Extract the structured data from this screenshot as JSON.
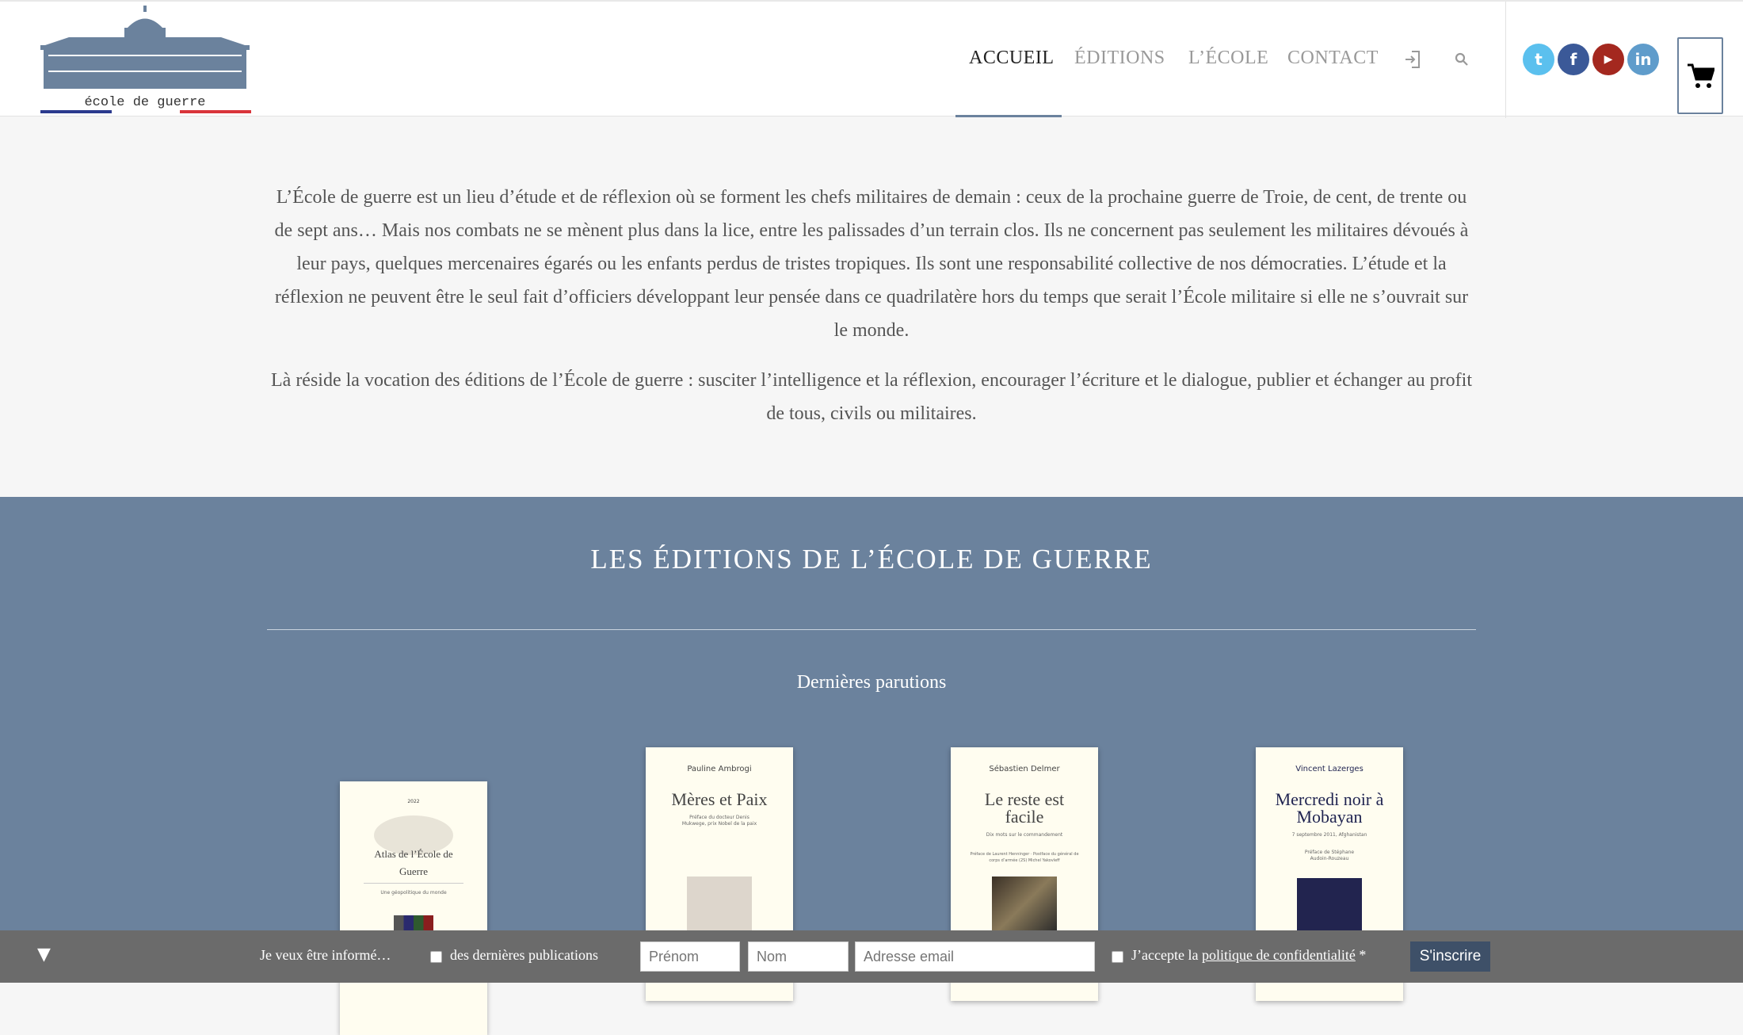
{
  "header": {
    "logo_text": "école de guerre",
    "nav": [
      {
        "label": "ACCUEIL",
        "active": true
      },
      {
        "label": "ÉDITIONS"
      },
      {
        "label": "L’ÉCOLE"
      },
      {
        "label": "CONTACT"
      }
    ],
    "icons": [
      "login-icon",
      "search-icon"
    ],
    "social": [
      {
        "name": "twitter",
        "color": "#5bc0ee",
        "glyph": "t"
      },
      {
        "name": "facebook",
        "color": "#3b5998",
        "glyph": "f"
      },
      {
        "name": "youtube",
        "color": "#a4281f",
        "glyph": "▶"
      },
      {
        "name": "linkedin",
        "color": "#5f9ccb",
        "glyph": "in"
      }
    ],
    "cart_icon": "cart-icon"
  },
  "intro": {
    "p1": "L’École de guerre est un lieu d’étude et de réflexion où se forment les chefs militaires de demain : ceux de la prochaine guerre de Troie, de cent, de trente ou de sept ans… Mais nos combats ne se mènent plus dans la lice, entre les palissades d’un terrain clos. Ils ne concernent pas seulement les militaires dévoués à leur pays, quelques mercenaires égarés ou les enfants perdus de tristes tropiques. Ils sont une responsabilité collective de nos démocraties. L’étude et la réflexion ne peuvent être le seul fait d’officiers développant leur pensée dans ce quadrilatère hors du temps que serait l’École militaire si elle ne s’ouvrait sur le monde.",
    "p2": "Là réside la vocation des éditions de l’École de guerre : susciter l’intelligence et la réflexion, encourager l’écriture et le dialogue, publier et échanger au profit de tous, civils ou militaires."
  },
  "editions": {
    "title": "LES ÉDITIONS DE L’ÉCOLE DE GUERRE",
    "subtitle": "Dernières parutions",
    "books": [
      {
        "author": "2022",
        "title": "Atlas de l’École de Guerre",
        "sub": "Une géopolitique du monde",
        "preface": ""
      },
      {
        "author": "Pauline Ambrogi",
        "title": "Mères et Paix",
        "sub": "",
        "preface": "Préface du docteur Denis Mukwege, prix Nobel de la paix"
      },
      {
        "author": "Sébastien Delmer",
        "title": "Le reste est facile",
        "sub": "Dix mots sur le commandement",
        "preface": "Préface de Laurent Henninger · Postface du général de corps d’armée (2S) Michel Yakovleff"
      },
      {
        "author": "Vincent Lazerges",
        "title": "Mercredi noir à Mobayan",
        "sub": "7 septembre 2011, Afghanistan",
        "preface": "Préface de Stéphane Audoin-Rouzeau"
      }
    ]
  },
  "newsletter": {
    "toggle": "▼",
    "lead": "Je veux être informé…",
    "option": "des dernières publications",
    "firstname_placeholder": "Prénom",
    "lastname_placeholder": "Nom",
    "email_placeholder": "Adresse email",
    "accept_prefix": "J’accepte la ",
    "accept_link": "politique de confidentialité",
    "accept_suffix": " *",
    "submit": "S'inscrire"
  }
}
